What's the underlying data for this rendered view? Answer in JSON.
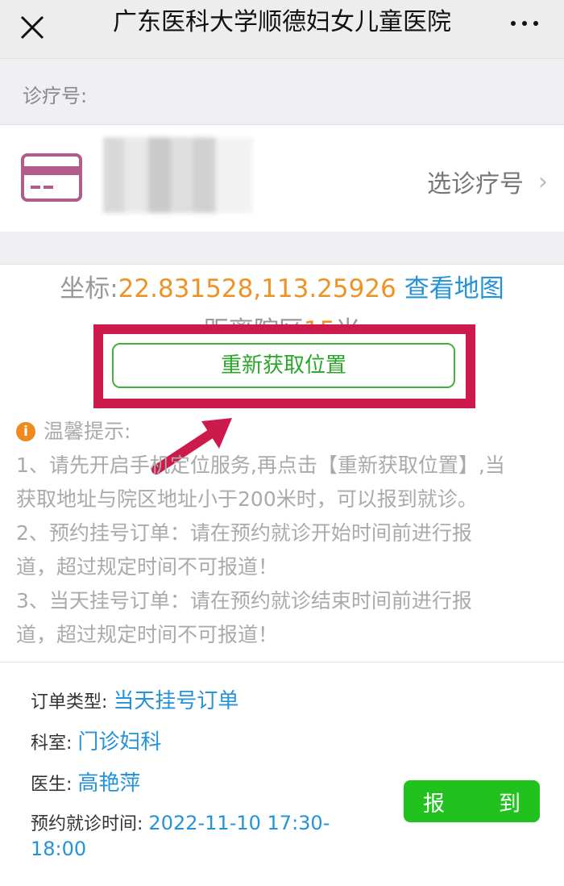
{
  "header": {
    "title": "广东医科大学顺德妇女儿童医院",
    "close_icon": "close-icon",
    "more_icon": "more-icon"
  },
  "card_section": {
    "label": "诊疗号:",
    "choose_label": "选诊疗号",
    "card_icon": "card-icon"
  },
  "location": {
    "coord_label": "坐标:",
    "coord_value": "22.831528,113.25926",
    "view_map_label": "查看地图",
    "distance_label": "距离院区",
    "distance_value": "15",
    "distance_unit": "米",
    "relocate_button": "重新获取位置"
  },
  "tips": {
    "title": "温馨提示:",
    "lines": [
      "1、请先开启手机定位服务,再点击【重新获取位置】,当",
      "获取地址与院区地址小于200米时，可以报到就诊。",
      "2、预约挂号订单：请在预约就诊开始时间前进行报",
      "道，超过规定时间不可报道！",
      "3、当天挂号订单：请在预约就诊结束时间前进行报",
      "道，超过规定时间不可报道！"
    ]
  },
  "order": {
    "type_label": "订单类型:",
    "type_value": "当天挂号订单",
    "dept_label": "科室:",
    "dept_value": "门诊妇科",
    "doctor_label": "医生:",
    "doctor_value": "高艳萍",
    "time_label": "预约就诊时间:",
    "time_value_line1": "2022-11-10 17:30-",
    "time_value_line2": "18:00",
    "checkin_char1": "报",
    "checkin_char2": "到"
  },
  "colors": {
    "accent_blue": "#2493d8",
    "accent_orange": "#ee9327",
    "green_button": "#21c21d",
    "highlight_red": "#cc1a4c"
  }
}
